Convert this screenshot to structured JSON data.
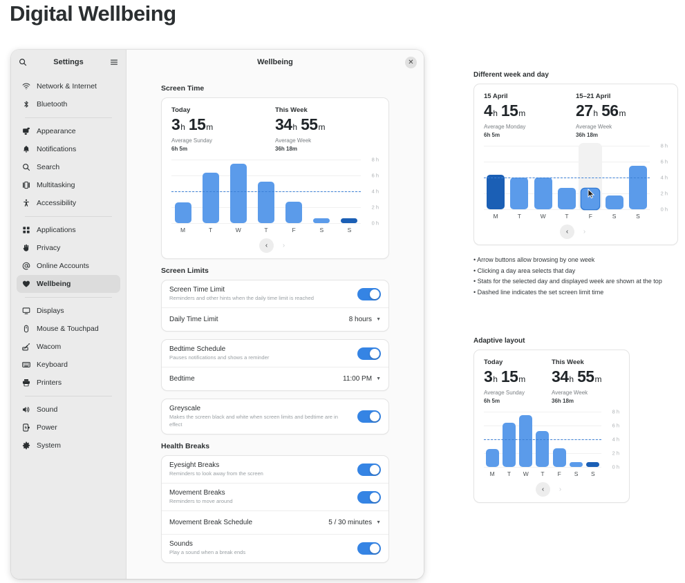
{
  "page": {
    "title": "Digital Wellbeing"
  },
  "window": {
    "sidebar": {
      "search_icon": "search-icon",
      "title": "Settings",
      "menu_icon": "hamburger-menu-icon",
      "groups": [
        {
          "items": [
            {
              "label": "Network & Internet",
              "icon": "wifi-icon"
            },
            {
              "label": "Bluetooth",
              "icon": "bluetooth-icon"
            }
          ]
        },
        {
          "items": [
            {
              "label": "Appearance",
              "icon": "appearance-icon"
            },
            {
              "label": "Notifications",
              "icon": "bell-icon"
            },
            {
              "label": "Search",
              "icon": "search-icon"
            },
            {
              "label": "Multitasking",
              "icon": "multitasking-icon"
            },
            {
              "label": "Accessibility",
              "icon": "accessibility-icon"
            }
          ]
        },
        {
          "items": [
            {
              "label": "Applications",
              "icon": "apps-grid-icon"
            },
            {
              "label": "Privacy",
              "icon": "privacy-hand-icon"
            },
            {
              "label": "Online Accounts",
              "icon": "at-sign-icon"
            },
            {
              "label": "Wellbeing",
              "icon": "heart-icon",
              "active": true
            }
          ]
        },
        {
          "items": [
            {
              "label": "Displays",
              "icon": "monitor-icon"
            },
            {
              "label": "Mouse & Touchpad",
              "icon": "mouse-icon"
            },
            {
              "label": "Wacom",
              "icon": "wacom-tablet-icon"
            },
            {
              "label": "Keyboard",
              "icon": "keyboard-icon"
            },
            {
              "label": "Printers",
              "icon": "printer-icon"
            }
          ]
        },
        {
          "items": [
            {
              "label": "Sound",
              "icon": "speaker-icon"
            },
            {
              "label": "Power",
              "icon": "battery-icon"
            },
            {
              "label": "System",
              "icon": "gear-icon"
            }
          ]
        }
      ]
    },
    "titlebar": {
      "title": "Wellbeing",
      "close_label": "✕",
      "close_icon": "close-icon"
    },
    "sections": {
      "screen_time": {
        "title": "Screen Time"
      },
      "screen_limits": {
        "title": "Screen Limits",
        "rows": [
          {
            "title": "Screen Time Limit",
            "subtitle": "Reminders and other hints when the daily time limit is reached",
            "control": "toggle",
            "state": "on"
          },
          {
            "title": "Daily Time Limit",
            "value": "8 hours",
            "control": "dropdown"
          },
          {
            "title": "Bedtime Schedule",
            "subtitle": "Pauses notifications and shows a reminder",
            "control": "toggle",
            "state": "on"
          },
          {
            "title": "Bedtime",
            "value": "11:00 PM",
            "control": "dropdown"
          },
          {
            "title": "Greyscale",
            "subtitle": "Makes the screen black and white when screen limits and bedtime are in effect",
            "control": "toggle",
            "state": "on"
          }
        ]
      },
      "health_breaks": {
        "title": "Health Breaks",
        "rows": [
          {
            "title": "Eyesight Breaks",
            "subtitle": "Reminders to look away from the screen",
            "control": "toggle",
            "state": "on"
          },
          {
            "title": "Movement Breaks",
            "subtitle": "Reminders to move around",
            "control": "toggle",
            "state": "on"
          },
          {
            "title": "Movement Break Schedule",
            "value": "5 / 30 minutes",
            "control": "dropdown"
          },
          {
            "title": "Sounds",
            "subtitle": "Play a sound when a break ends",
            "control": "toggle",
            "state": "on"
          }
        ]
      }
    }
  },
  "annotations": {
    "week_day": {
      "title": "Different week and day"
    },
    "bullets": [
      "Arrow buttons allow browsing by one week",
      "Clicking a day area selects that day",
      "Stats for the selected day and displayed week are shown at the top",
      "Dashed line indicates the set screen limit time"
    ],
    "adaptive": {
      "title": "Adaptive layout"
    }
  },
  "nav": {
    "prev": "‹",
    "next": "›",
    "prev_icon": "chevron-left-icon",
    "next_icon": "chevron-right-icon"
  },
  "colors": {
    "bar": "#5b9bea",
    "bar_selected": "#1b5fb5",
    "limit_line": "#3a7fd5",
    "toggle_on": "#3584e4",
    "hover_column": "#f2f2f2"
  },
  "chart_data": [
    {
      "id": "screen-time-main",
      "type": "bar",
      "title": "Screen Time",
      "xlabel": "",
      "ylabel": "",
      "ylim": [
        0,
        8
      ],
      "yticks": [
        0,
        2,
        4,
        6,
        8
      ],
      "ytick_labels": [
        "0 h",
        "2 h",
        "4 h",
        "6 h",
        "8 h"
      ],
      "grid": true,
      "legend": "none",
      "categories": [
        "M",
        "T",
        "W",
        "T",
        "F",
        "S",
        "S"
      ],
      "values": [
        2.6,
        6.4,
        7.5,
        5.2,
        2.7,
        0.35,
        0.5
      ],
      "selected_index": 6,
      "hovered_index": null,
      "limit_line": 4,
      "stats": {
        "left_label": "Today",
        "left_hours": "3",
        "left_h_unit": "h",
        "left_minutes": "15",
        "left_m_unit": "m",
        "left_sub_label": "Average Sunday",
        "left_sub_value": "6h 5m",
        "right_label": "This Week",
        "right_hours": "34",
        "right_h_unit": "h",
        "right_minutes": "55",
        "right_m_unit": "m",
        "right_sub_label": "Average Week",
        "right_sub_value": "36h 18m"
      },
      "nav": {
        "prev_enabled": true,
        "next_enabled": false
      }
    },
    {
      "id": "different-week-and-day",
      "type": "bar",
      "title": "Different week and day",
      "xlabel": "",
      "ylabel": "",
      "ylim": [
        0,
        8
      ],
      "yticks": [
        0,
        2,
        4,
        6,
        8
      ],
      "ytick_labels": [
        "0 h",
        "2 h",
        "4 h",
        "6 h",
        "8 h"
      ],
      "grid": true,
      "legend": "none",
      "categories": [
        "M",
        "T",
        "W",
        "T",
        "F",
        "S",
        "S"
      ],
      "values": [
        4.35,
        4.05,
        4.05,
        2.75,
        2.6,
        1.75,
        5.5
      ],
      "selected_index": 0,
      "hovered_index": 4,
      "limit_line": 4,
      "stats": {
        "left_label": "15 April",
        "left_hours": "4",
        "left_h_unit": "h",
        "left_minutes": "15",
        "left_m_unit": "m",
        "left_sub_label": "Average Monday",
        "left_sub_value": "6h 5m",
        "right_label": "15–21 April",
        "right_hours": "27",
        "right_h_unit": "h",
        "right_minutes": "56",
        "right_m_unit": "m",
        "right_sub_label": "Average Week",
        "right_sub_value": "36h 18m"
      },
      "nav": {
        "prev_enabled": true,
        "next_enabled": false
      }
    },
    {
      "id": "adaptive-layout",
      "type": "bar",
      "title": "Adaptive layout",
      "xlabel": "",
      "ylabel": "",
      "ylim": [
        0,
        8
      ],
      "yticks": [
        0,
        2,
        4,
        6,
        8
      ],
      "ytick_labels": [
        "0 h",
        "2 h",
        "4 h",
        "6 h",
        "8 h"
      ],
      "grid": true,
      "legend": "none",
      "categories": [
        "M",
        "T",
        "W",
        "T",
        "F",
        "S",
        "S"
      ],
      "values": [
        2.6,
        6.4,
        7.5,
        5.2,
        2.7,
        0.35,
        0.5
      ],
      "selected_index": 6,
      "hovered_index": null,
      "limit_line": 4,
      "stats": {
        "left_label": "Today",
        "left_hours": "3",
        "left_h_unit": "h",
        "left_minutes": "15",
        "left_m_unit": "m",
        "left_sub_label": "Average Sunday",
        "left_sub_value": "6h 5m",
        "right_label": "This Week",
        "right_hours": "34",
        "right_h_unit": "h",
        "right_minutes": "55",
        "right_m_unit": "m",
        "right_sub_label": "Average Week",
        "right_sub_value": "36h 18m"
      },
      "nav": {
        "prev_enabled": true,
        "next_enabled": false
      }
    }
  ]
}
